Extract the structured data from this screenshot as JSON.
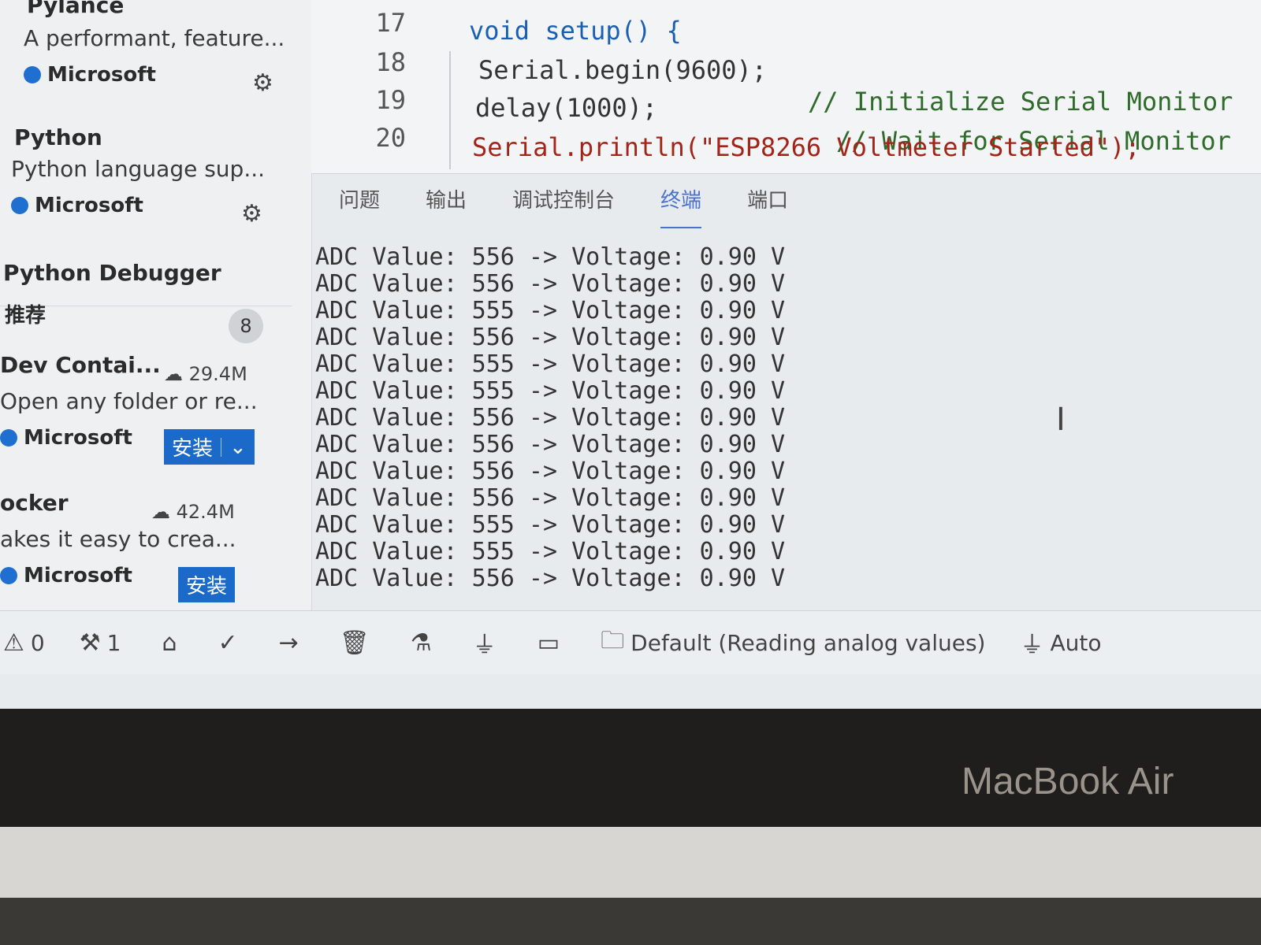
{
  "sidebar": {
    "extensions": [
      {
        "name": "Pylance",
        "description": "A performant, feature...",
        "publisher": "Microsoft"
      },
      {
        "name": "Python",
        "description": "Python language sup...",
        "publisher": "Microsoft"
      },
      {
        "name": "Python Debugger"
      }
    ],
    "recommended": {
      "header": "推荐",
      "count": "8",
      "items": [
        {
          "name": "Dev Contai...",
          "size": "29.4M",
          "description": "Open any folder or re...",
          "publisher": "Microsoft",
          "install_label": "安装"
        },
        {
          "name": "ocker",
          "size": "42.4M",
          "description": "akes it easy to crea...",
          "publisher": "Microsoft",
          "install_label": "安装"
        }
      ]
    }
  },
  "editor": {
    "lines": [
      {
        "number": "17",
        "text": "void setup() {"
      },
      {
        "number": "18",
        "text": "Serial.begin(9600);",
        "comment": "// Initialize Serial Monitor"
      },
      {
        "number": "19",
        "text": "delay(1000);",
        "comment": "// Wait for Serial Monitor"
      },
      {
        "number": "20",
        "text": "Serial.println(\"ESP8266 Voltmeter Started\");"
      }
    ]
  },
  "panel": {
    "tabs": [
      "问题",
      "输出",
      "调试控制台",
      "终端",
      "端口"
    ],
    "active_tab": "终端"
  },
  "terminal": {
    "lines": [
      "ADC Value: 556 -> Voltage: 0.90 V",
      "ADC Value: 556 -> Voltage: 0.90 V",
      "ADC Value: 555 -> Voltage: 0.90 V",
      "ADC Value: 556 -> Voltage: 0.90 V",
      "ADC Value: 555 -> Voltage: 0.90 V",
      "ADC Value: 555 -> Voltage: 0.90 V",
      "ADC Value: 556 -> Voltage: 0.90 V",
      "ADC Value: 556 -> Voltage: 0.90 V",
      "ADC Value: 556 -> Voltage: 0.90 V",
      "ADC Value: 556 -> Voltage: 0.90 V",
      "ADC Value: 555 -> Voltage: 0.90 V",
      "ADC Value: 555 -> Voltage: 0.90 V",
      "ADC Value: 556 -> Voltage: 0.90 V"
    ]
  },
  "statusbar": {
    "warnings": "0",
    "tools_count": "1",
    "profile": "Default (Reading analog values)",
    "port_mode": "Auto"
  },
  "device": {
    "label": "MacBook Air"
  },
  "colors": {
    "accent": "#1b6ac9",
    "active_tab": "#4a72c9",
    "background": "#e8ebee"
  }
}
